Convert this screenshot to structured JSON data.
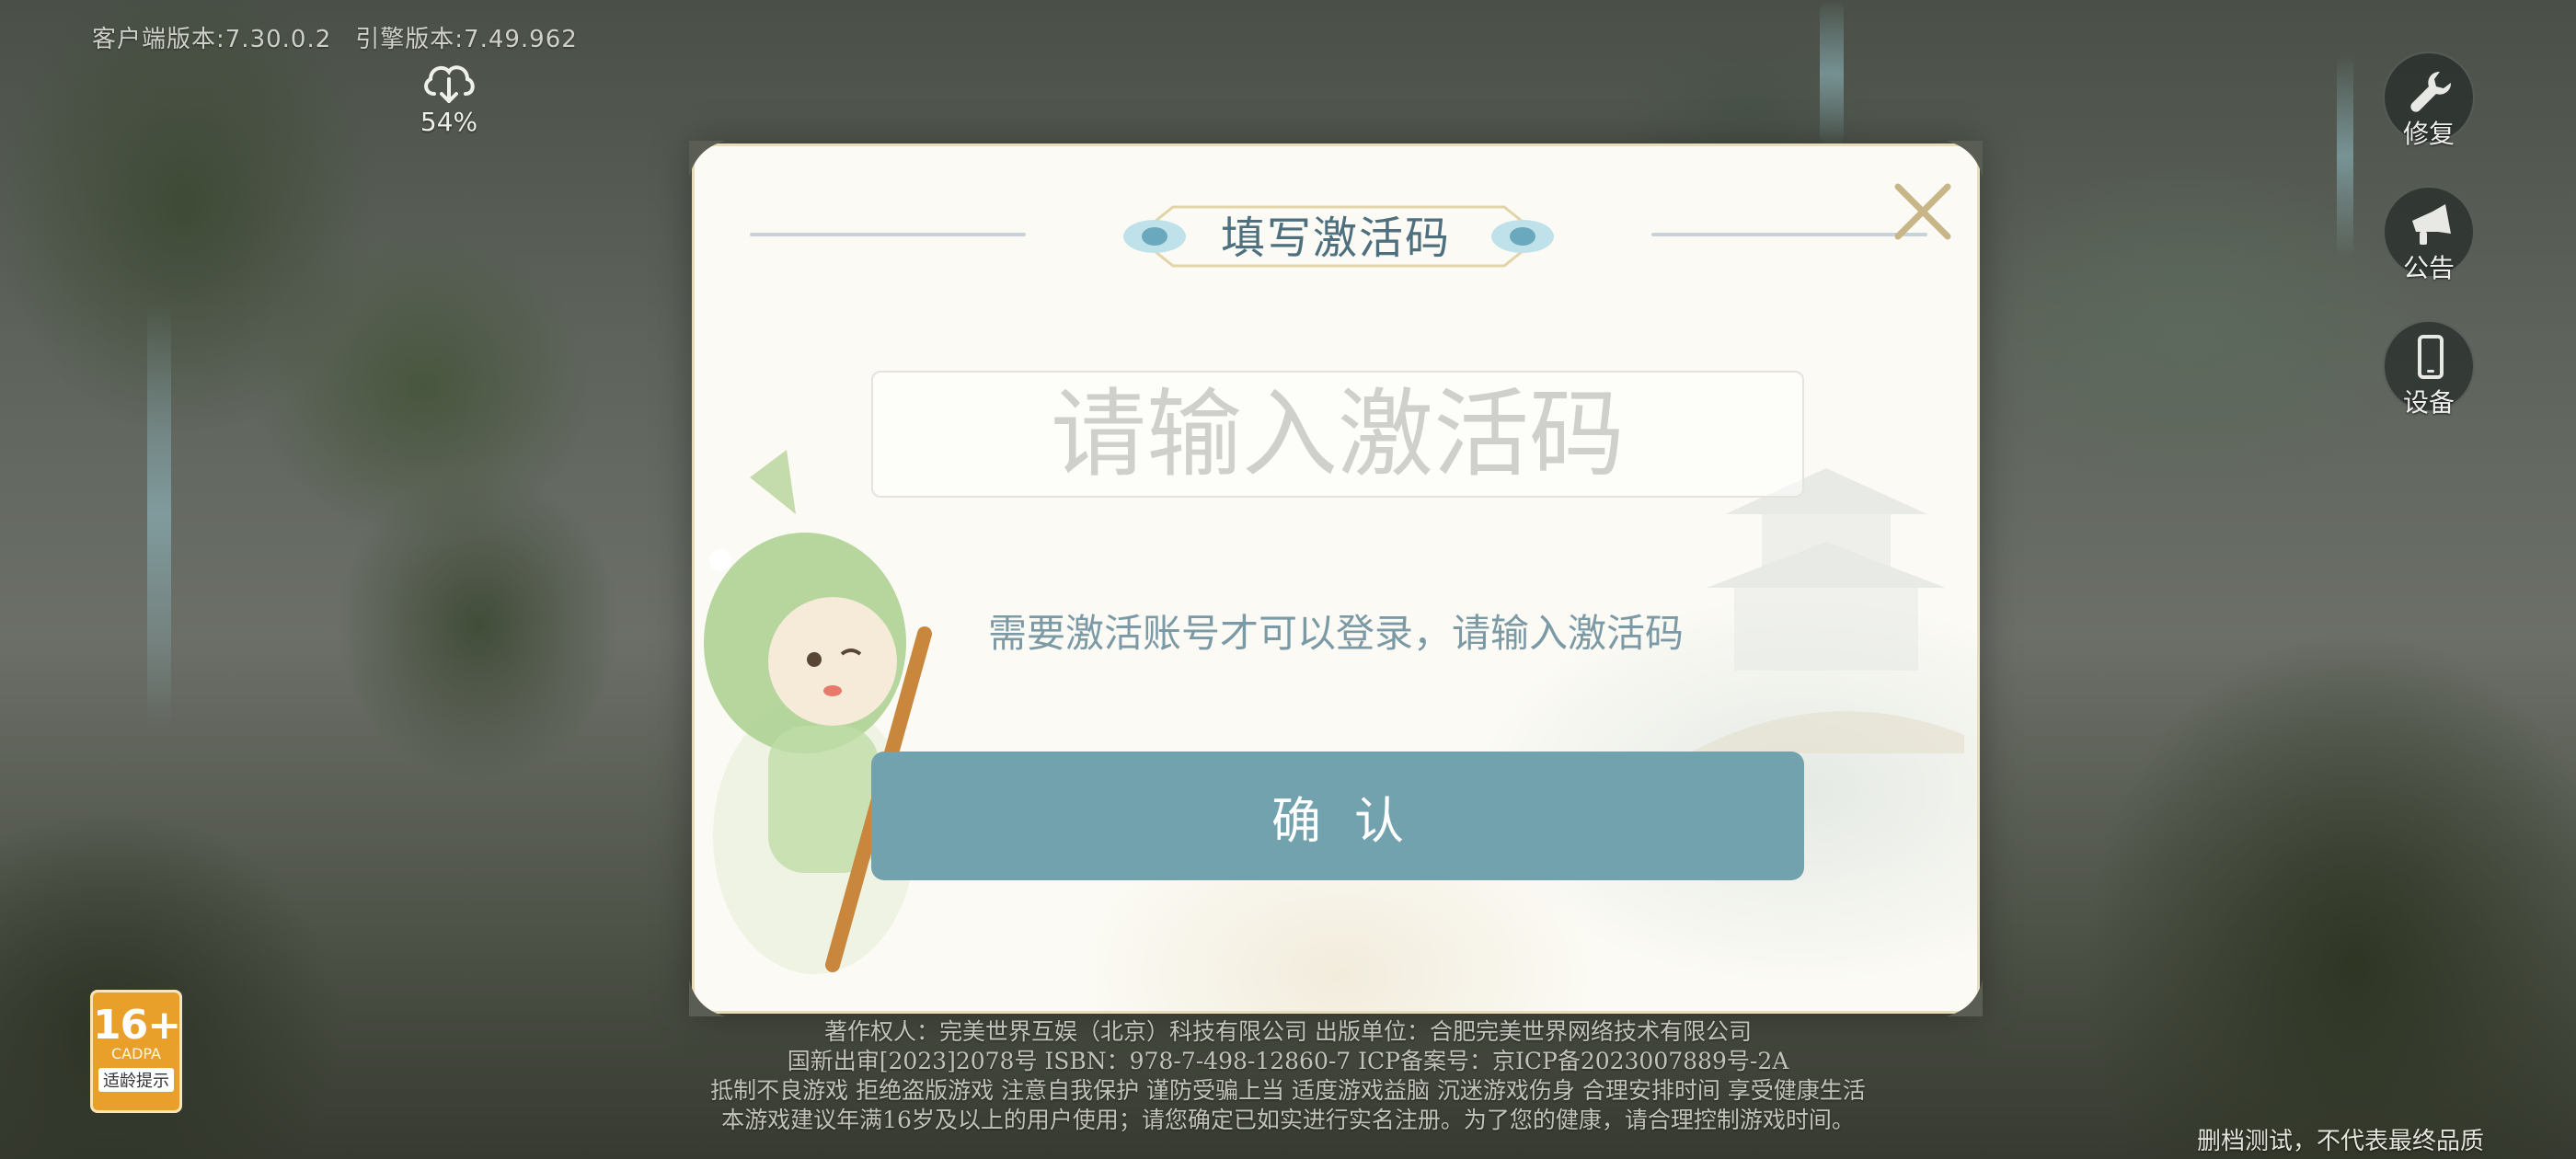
{
  "version": {
    "client": "客户端版本:7.30.0.2",
    "engine": "引擎版本:7.49.962"
  },
  "download": {
    "icon": "cloud-download-icon",
    "percent": "54%"
  },
  "side_buttons": [
    {
      "icon": "wrench-icon",
      "label": "修复"
    },
    {
      "icon": "megaphone-icon",
      "label": "公告"
    },
    {
      "icon": "phone-icon",
      "label": "设备"
    }
  ],
  "dialog": {
    "title": "填写激活码",
    "close_icon": "close-icon",
    "input_value": "",
    "input_placeholder": "请输入激活码",
    "hint": "需要激活账号才可以登录，请输入激活码",
    "confirm_label": "确认"
  },
  "age_badge": {
    "rating": "16+",
    "org": "CADPA",
    "tip": "适龄提示"
  },
  "legal": [
    "著作权人：完美世界互娱（北京）科技有限公司 出版单位：合肥完美世界网络技术有限公司",
    "国新出审[2023]2078号 ISBN：978-7-498-12860-7 ICP备案号：京ICP备2023007889号-2A",
    "抵制不良游戏 拒绝盗版游戏 注意自我保护 谨防受骗上当 适度游戏益脑 沉迷游戏伤身 合理安排时间 享受健康生活",
    "本游戏建议年满16岁及以上的用户使用；请您确定已如实进行实名注册。为了您的健康，请合理控制游戏时间。"
  ],
  "disclaimer": "删档测试，不代表最终品质",
  "colors": {
    "accent": "#72a2ad",
    "title": "#4d6f7e",
    "dialog_bg": "#fbfaf4",
    "gold": "#c8b688"
  }
}
